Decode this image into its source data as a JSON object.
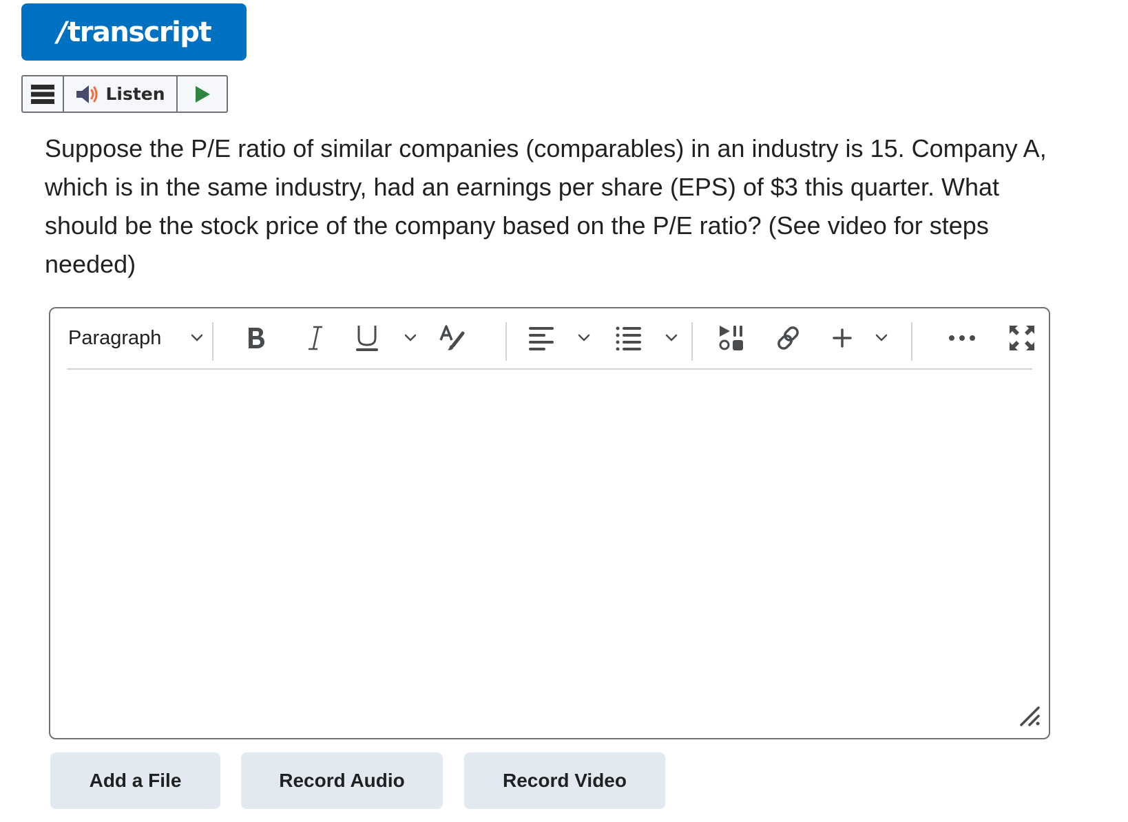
{
  "header": {
    "brand_slash": "/",
    "brand_name": "transcript"
  },
  "listen_bar": {
    "menu_icon": "hamburger-menu-icon",
    "speaker_icon": "speaker-icon",
    "listen_label": "Listen",
    "play_icon": "play-icon"
  },
  "question": {
    "text": "Suppose the P/E ratio of similar companies (comparables) in an industry is 15. Company A, which is in the same industry, had an earnings per share (EPS) of $3 this quarter. What should be the stock price of the company based on the P/E ratio? (See video for steps needed)"
  },
  "editor": {
    "format_select": "Paragraph",
    "toolbar": [
      {
        "name": "bold",
        "icon": "bold-icon"
      },
      {
        "name": "italic",
        "icon": "italic-icon"
      },
      {
        "name": "underline",
        "icon": "underline-icon",
        "dropdown": true
      },
      {
        "name": "text-color",
        "icon": "text-color-icon"
      },
      {
        "name": "align",
        "icon": "align-left-icon",
        "dropdown": true
      },
      {
        "name": "list",
        "icon": "bullet-list-icon",
        "dropdown": true
      },
      {
        "name": "media",
        "icon": "insert-media-icon"
      },
      {
        "name": "link",
        "icon": "link-icon"
      },
      {
        "name": "insert",
        "icon": "plus-icon",
        "dropdown": true
      },
      {
        "name": "more",
        "icon": "more-icon"
      },
      {
        "name": "fullscreen",
        "icon": "fullscreen-icon"
      }
    ],
    "content": ""
  },
  "actions": {
    "add_file": "Add a File",
    "record_audio": "Record Audio",
    "record_video": "Record Video"
  },
  "colors": {
    "brand": "#0070c0",
    "play": "#2e8540",
    "speaker_wave": "#f26b3a",
    "icon": "#494c4e",
    "button_bg": "#e3e9f1"
  }
}
